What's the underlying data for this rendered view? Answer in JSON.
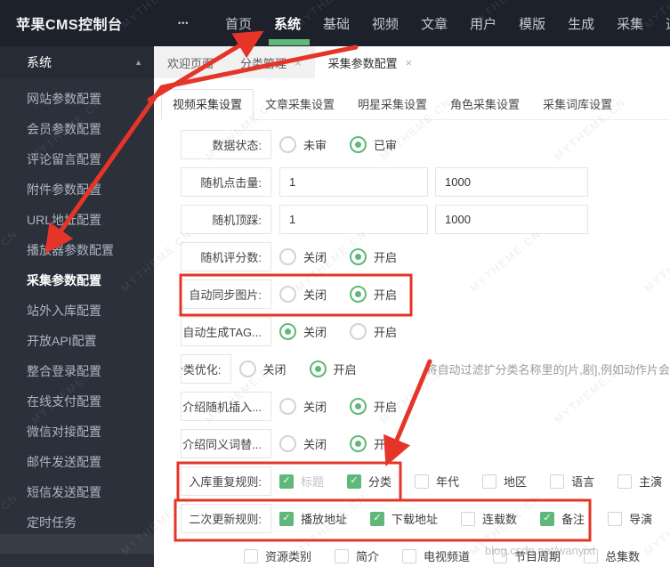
{
  "colors": {
    "accent_green": "#5FB878",
    "annotation_red": "#e53528",
    "topbar_bg": "#1d212b",
    "sidebar_bg": "#2b303b"
  },
  "icons": {
    "more": "•••",
    "collapse": "▲",
    "close": "×",
    "check": "✓"
  },
  "topbar": {
    "title": "苹果CMS控制台",
    "items": [
      {
        "label": "首页"
      },
      {
        "label": "系统",
        "active": true
      },
      {
        "label": "基础"
      },
      {
        "label": "视频"
      },
      {
        "label": "文章"
      },
      {
        "label": "用户"
      },
      {
        "label": "模版"
      },
      {
        "label": "生成"
      },
      {
        "label": "采集"
      },
      {
        "label": "选",
        "partial": true
      }
    ]
  },
  "sidebar": {
    "header": {
      "label": "系统"
    },
    "items": [
      {
        "label": "网站参数配置"
      },
      {
        "label": "会员参数配置"
      },
      {
        "label": "评论留言配置"
      },
      {
        "label": "附件参数配置"
      },
      {
        "label": "URL地址配置"
      },
      {
        "label": "播放器参数配置"
      },
      {
        "label": "采集参数配置",
        "active": true
      },
      {
        "label": "站外入库配置"
      },
      {
        "label": "开放API配置"
      },
      {
        "label": "整合登录配置"
      },
      {
        "label": "在线支付配置"
      },
      {
        "label": "微信对接配置"
      },
      {
        "label": "邮件发送配置"
      },
      {
        "label": "短信发送配置"
      },
      {
        "label": "定时任务"
      }
    ]
  },
  "tabs": {
    "items": [
      {
        "label": "欢迎页面",
        "closable": false
      },
      {
        "label": "分类管理",
        "closable": true
      },
      {
        "label": "采集参数配置",
        "closable": true,
        "active": true
      }
    ]
  },
  "subtabs": [
    {
      "label": "视频采集设置",
      "active": true
    },
    {
      "label": "文章采集设置"
    },
    {
      "label": "明星采集设置"
    },
    {
      "label": "角色采集设置"
    },
    {
      "label": "采集词库设置"
    }
  ],
  "form": {
    "rows": [
      {
        "label": "数据状态:",
        "type": "radio",
        "options": [
          {
            "label": "未审",
            "checked": false
          },
          {
            "label": "已审",
            "checked": true
          }
        ]
      },
      {
        "label": "随机点击量:",
        "type": "inputs",
        "values": [
          "1",
          "1000"
        ]
      },
      {
        "label": "随机顶踩:",
        "type": "inputs",
        "values": [
          "1",
          "1000"
        ]
      },
      {
        "label": "随机评分数:",
        "type": "radio",
        "options": [
          {
            "label": "关闭",
            "checked": false
          },
          {
            "label": "开启",
            "checked": true
          }
        ]
      },
      {
        "label": "自动同步图片:",
        "type": "radio",
        "highlighted": true,
        "options": [
          {
            "label": "关闭",
            "checked": false
          },
          {
            "label": "开启",
            "checked": true
          }
        ]
      },
      {
        "label": "自动生成TAG...",
        "type": "radio",
        "options": [
          {
            "label": "关闭",
            "checked": true
          },
          {
            "label": "开启",
            "checked": false
          }
        ]
      },
      {
        "label": "扩展分类优化:",
        "type": "radio",
        "options": [
          {
            "label": "关闭",
            "checked": false
          },
          {
            "label": "开启",
            "checked": true
          }
        ],
        "note": "将自动过滤扩分类名称里的[片,剧],例如动作片会"
      },
      {
        "label": "介绍随机插入...",
        "type": "radio",
        "options": [
          {
            "label": "关闭",
            "checked": false
          },
          {
            "label": "开启",
            "checked": true
          }
        ]
      },
      {
        "label": "介绍同义词替...",
        "type": "radio",
        "options": [
          {
            "label": "关闭",
            "checked": false
          },
          {
            "label": "开启",
            "checked": true
          }
        ]
      },
      {
        "label": "入库重复规则:",
        "type": "checkbox",
        "highlighted": true,
        "options": [
          {
            "label": "标题",
            "checked": true,
            "disabled": true
          },
          {
            "label": "分类",
            "checked": true
          },
          {
            "label": "年代",
            "checked": false
          },
          {
            "label": "地区",
            "checked": false
          },
          {
            "label": "语言",
            "checked": false
          },
          {
            "label": "主演",
            "checked": false
          }
        ]
      },
      {
        "label": "二次更新规则:",
        "type": "checkbox",
        "highlighted": true,
        "options": [
          {
            "label": "播放地址",
            "checked": true
          },
          {
            "label": "下载地址",
            "checked": true
          },
          {
            "label": "连载数",
            "checked": false
          },
          {
            "label": "备注",
            "checked": true
          },
          {
            "label": "导演",
            "checked": false
          }
        ]
      },
      {
        "label": "",
        "type": "checkbox",
        "options": [
          {
            "label": "资源类别",
            "checked": false
          },
          {
            "label": "简介",
            "checked": false
          },
          {
            "label": "电视频道",
            "checked": false
          },
          {
            "label": "节目周期",
            "checked": false
          },
          {
            "label": "总集数",
            "checked": false
          }
        ]
      }
    ]
  },
  "watermark": {
    "text": "MYTHEME.CN",
    "csdn": "blog.csdn.net/wanyixt"
  }
}
